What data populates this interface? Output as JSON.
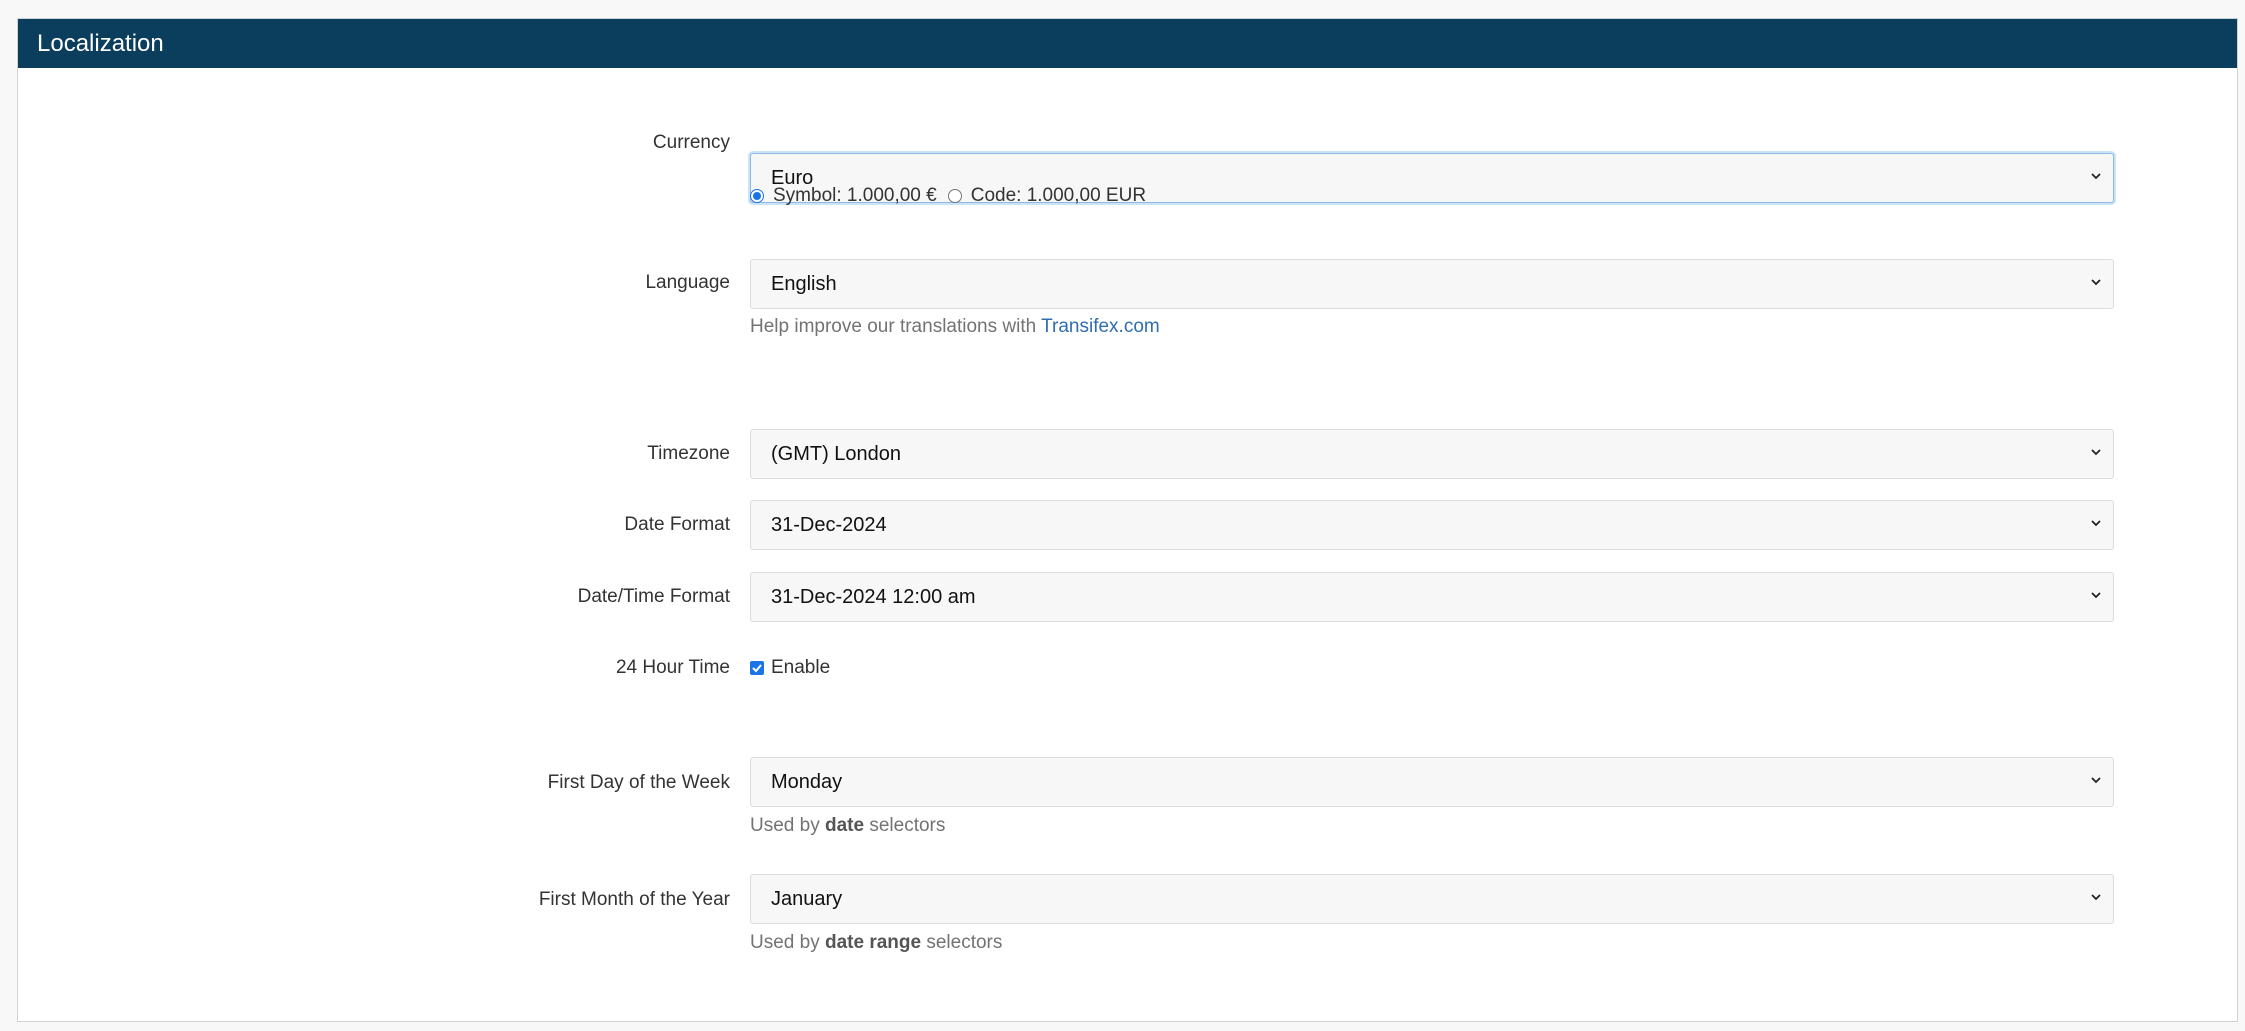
{
  "panel": {
    "title": "Localization"
  },
  "currency": {
    "label": "Currency",
    "value": "Euro",
    "options": [
      {
        "label": "Symbol: 1.000,00 €",
        "selected": true
      },
      {
        "label": "Code: 1.000,00 EUR",
        "selected": false
      }
    ]
  },
  "language": {
    "label": "Language",
    "value": "English",
    "help_prefix": "Help improve our translations with",
    "help_link": "Transifex.com"
  },
  "timezone": {
    "label": "Timezone",
    "value": "(GMT) London"
  },
  "date_format": {
    "label": "Date Format",
    "value": "31-Dec-2024"
  },
  "datetime_format": {
    "label": "Date/Time Format",
    "value": "31-Dec-2024 12:00 am"
  },
  "hour24": {
    "label": "24 Hour Time",
    "checkbox_label": "Enable",
    "checked": true
  },
  "first_day": {
    "label": "First Day of the Week",
    "value": "Monday",
    "help_prefix": "Used by",
    "help_bold": "date",
    "help_suffix": "selectors"
  },
  "first_month": {
    "label": "First Month of the Year",
    "value": "January",
    "help_prefix": "Used by",
    "help_bold": "date range",
    "help_suffix": "selectors"
  },
  "colors": {
    "header_bg": "#0b3d5c",
    "accent": "#1a73e8",
    "link": "#2f6eb0"
  },
  "icons": {
    "select_arrow": "chevron-down-icon"
  }
}
